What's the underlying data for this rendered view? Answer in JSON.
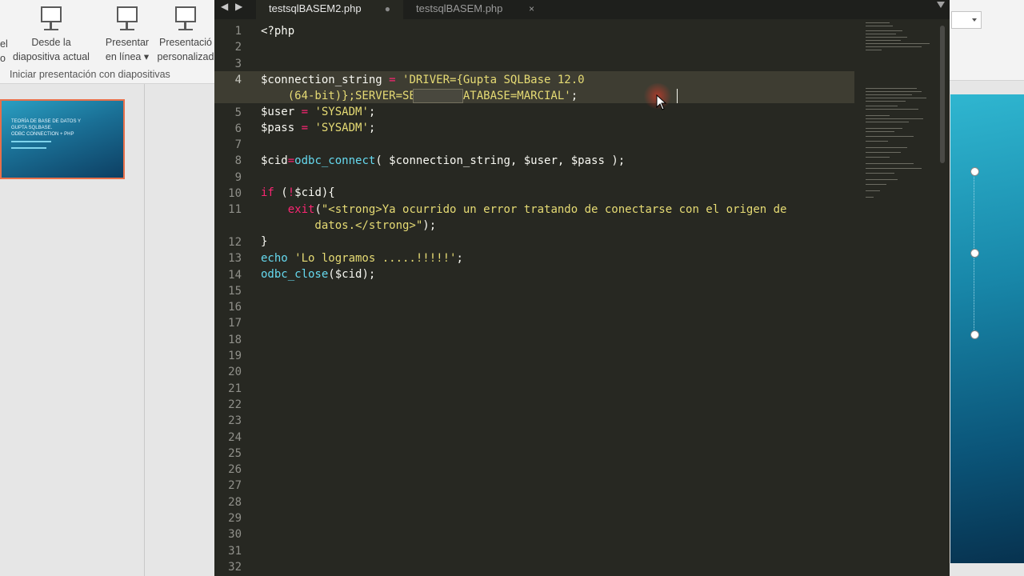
{
  "powerpoint": {
    "ribbon": {
      "cut_label_top": "el",
      "cut_label_bottom": "o",
      "buttons": [
        {
          "line1": "Desde la",
          "line2": "diapositiva actual"
        },
        {
          "line1": "Presentar",
          "line2": "en línea ▾"
        },
        {
          "line1": "Presentació",
          "line2": "personalizad"
        }
      ],
      "group_label": "Iniciar presentación con diapositivas"
    },
    "thumbnail": {
      "title_lines": [
        "TEORÍA DE BASE DE DATOS Y",
        "GUPTA SQLBASE.",
        "ODBC CONNECTION + PHP"
      ]
    }
  },
  "editor": {
    "tabs": [
      {
        "label": "testsqlBASEM2.php",
        "control": "●"
      },
      {
        "label": "testsqlBASEM.php",
        "control": "×"
      }
    ],
    "nav_left": "◀",
    "nav_right": "▶",
    "line_numbers": [
      "1",
      "2",
      "3",
      "4",
      "",
      "5",
      "6",
      "7",
      "8",
      "9",
      "10",
      "11",
      "",
      "12",
      "13",
      "14",
      "15",
      "16",
      "17",
      "18",
      "19",
      "20",
      "21",
      "22",
      "23",
      "24",
      "25",
      "26",
      "27",
      "28",
      "29",
      "30",
      "31",
      "32"
    ],
    "code": {
      "l1": "<?php",
      "l4a_var": "$connection_string",
      "l4a_op": " = ",
      "l4a_str": "'DRIVER={Gupta SQLBase 12.0",
      "l4b_str": "    (64-bit)};SERVER=SERVER1;DATABASE=MARCIAL'",
      "l4b_end": ";",
      "l5_var": "$user",
      "l5_op": " = ",
      "l5_str": "'SYSADM'",
      "l5_end": ";",
      "l6_var": "$pass",
      "l6_op": " = ",
      "l6_str": "'SYSADM'",
      "l6_end": ";",
      "l8_var": "$cid",
      "l8_op": "=",
      "l8_fn": "odbc_connect",
      "l8_rest": "( $connection_string, $user, $pass );",
      "l10_kw": "if",
      "l10_a": " (",
      "l10_not": "!",
      "l10_b": "$cid){",
      "l11_fn": "    exit",
      "l11_a": "(",
      "l11_str": "\"<strong>Ya ocurrido un error tratando de conectarse con el origen de",
      "l11b_str": "        datos.</strong>\"",
      "l11b_end": ");",
      "l12": "}",
      "l13_fn": "echo",
      "l13_str": " 'Lo logramos .....!!!!!'",
      "l13_end": ";",
      "l14_fn": "odbc_close",
      "l14_rest": "($cid);"
    }
  }
}
